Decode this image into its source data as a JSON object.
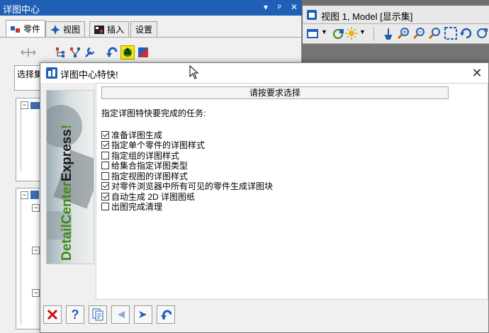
{
  "left_panel": {
    "title": "详图中心",
    "title_controls": [
      "▾",
      "ᵖ",
      "✕"
    ],
    "tabs": [
      {
        "label": "零件",
        "icon": "parts-icon"
      },
      {
        "label": "视图",
        "icon": "view-icon"
      },
      {
        "label": "插入",
        "icon": "insert-icon"
      },
      {
        "label": "设置",
        "icon": ""
      }
    ],
    "select_field_text": "选择集"
  },
  "view_panel": {
    "title": "视图 1, Model [显示集]"
  },
  "dialog": {
    "title": "详图中心特快!",
    "close_glyph": "✕",
    "header": "请按要求选择",
    "prompt": "指定详图特快要完成的任务:",
    "banner": {
      "part1": "DetailCenter",
      "part2": "Express",
      "part3": "!"
    },
    "tasks": [
      {
        "label": "准备详图生成",
        "checked": true
      },
      {
        "label": "指定单个零件的详图样式",
        "checked": true
      },
      {
        "label": "指定组的详图样式",
        "checked": false
      },
      {
        "label": "给集合指定详图类型",
        "checked": false
      },
      {
        "label": "指定视图的详图样式",
        "checked": false
      },
      {
        "label": "对零件浏览器中所有可见的零件生成详图块",
        "checked": true
      },
      {
        "label": "自动生成 2D 详图图纸",
        "checked": true
      },
      {
        "label": "出图完成清理",
        "checked": false
      }
    ],
    "footer_buttons": [
      "cancel-icon",
      "help-icon",
      "copy-icon",
      "back-icon",
      "next-icon",
      "finish-icon"
    ]
  },
  "colors": {
    "title_blue": "#1f5fb5",
    "highlight_yellow": "#f4e800",
    "banner_green": "#3d8a1a"
  }
}
